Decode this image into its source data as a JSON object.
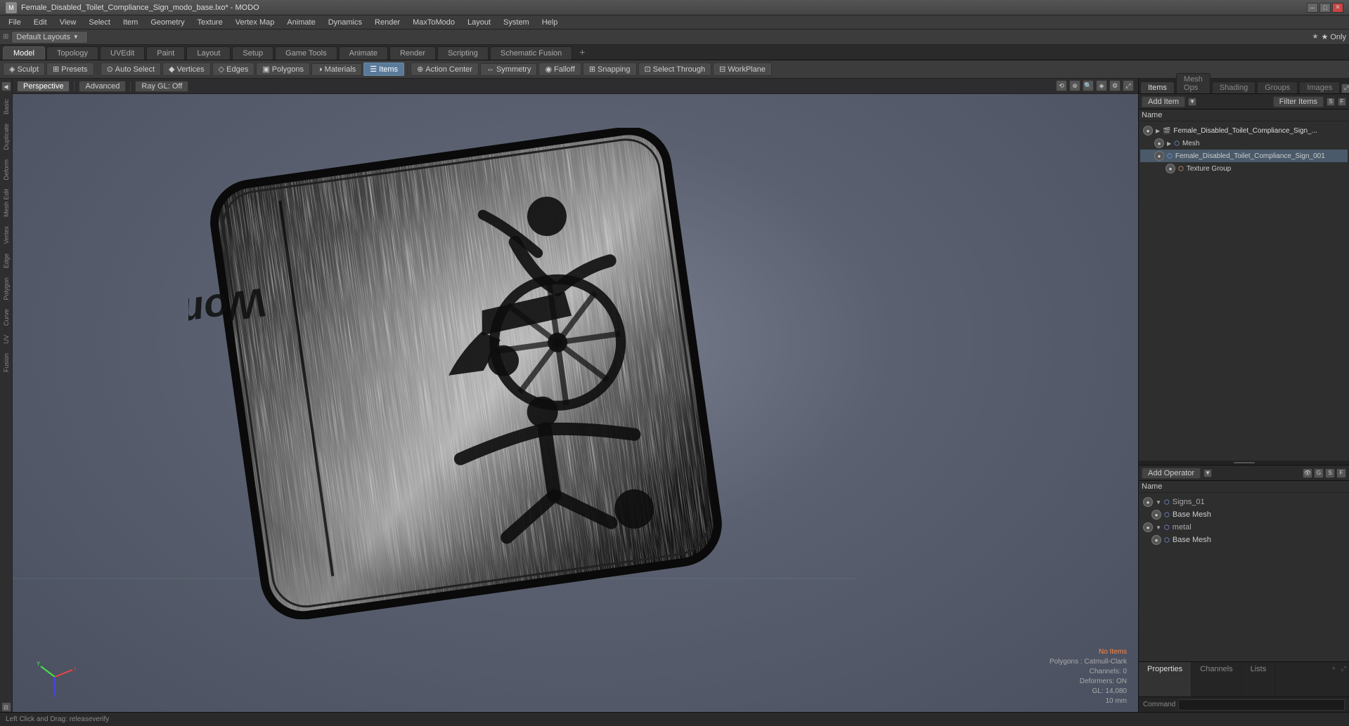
{
  "titleBar": {
    "title": "Female_Disabled_Toilet_Compliance_Sign_modo_base.lxo* - MODO",
    "controls": [
      "minimize",
      "maximize",
      "close"
    ]
  },
  "menuBar": {
    "items": [
      "File",
      "Edit",
      "View",
      "Select",
      "Item",
      "Geometry",
      "Texture",
      "Vertex Map",
      "Animate",
      "Dynamics",
      "Render",
      "MaxToModo",
      "Layout",
      "System",
      "Help"
    ]
  },
  "layoutBar": {
    "dropdown": "Default Layouts",
    "star_label": "★  Only"
  },
  "tabBar": {
    "tabs": [
      "Model",
      "Topology",
      "UVEdit",
      "Paint",
      "Layout",
      "Setup",
      "Game Tools",
      "Animate",
      "Render",
      "Scripting",
      "Schematic Fusion"
    ]
  },
  "toolbar": {
    "sculpt_label": "Sculpt",
    "presets_label": "Presets",
    "auto_select_label": "Auto Select",
    "vertices_label": "Vertices",
    "edges_label": "Edges",
    "polygons_label": "Polygons",
    "materials_label": "Materials",
    "items_label": "Items",
    "action_center_label": "Action Center",
    "symmetry_label": "Symmetry",
    "falloff_label": "Falloff",
    "snapping_label": "Snapping",
    "select_through_label": "Select Through",
    "workplane_label": "WorkPlane"
  },
  "viewport": {
    "perspective_label": "Perspective",
    "advanced_label": "Advanced",
    "ray_gl_label": "Ray GL: Off",
    "sign_text": "Women's",
    "status": {
      "no_items": "No Items",
      "polygons": "Polygons : Catmull-Clark",
      "channels": "Channels: 0",
      "deformers": "Deformers: ON",
      "gl": "GL: 14,080",
      "mm": "10 mm"
    }
  },
  "rightPanel": {
    "tabs": [
      "Items",
      "Mesh Ops",
      "Shading",
      "Groups",
      "Images"
    ],
    "addItem_label": "Add Item",
    "filterItems_label": "Filter Items",
    "column_name": "Name",
    "items": [
      {
        "name": "Female_Disabled_Toilet_Compliance_Sign_...",
        "type": "scene",
        "indent": 0,
        "expanded": true
      },
      {
        "name": "Mesh",
        "type": "mesh",
        "indent": 1,
        "expanded": false
      },
      {
        "name": "Female_Disabled_Toilet_Compliance_Sign_001",
        "type": "mesh",
        "indent": 1,
        "expanded": false
      },
      {
        "name": "Texture Group",
        "type": "texture",
        "indent": 2,
        "expanded": false
      }
    ]
  },
  "schematicPanel": {
    "addOperator_label": "Add Operator",
    "column_name": "Name",
    "groups": [
      {
        "name": "Signs_01",
        "expanded": true,
        "children": [
          {
            "name": "Base Mesh"
          }
        ]
      },
      {
        "name": "metal",
        "expanded": true,
        "children": [
          {
            "name": "Base Mesh"
          }
        ]
      }
    ]
  },
  "bottomPanel": {
    "tabs": [
      "Properties",
      "Channels",
      "Lists"
    ],
    "command_label": "Command"
  },
  "statusBar": {
    "left_click": "Left Click and Drag:  releaseverify"
  }
}
